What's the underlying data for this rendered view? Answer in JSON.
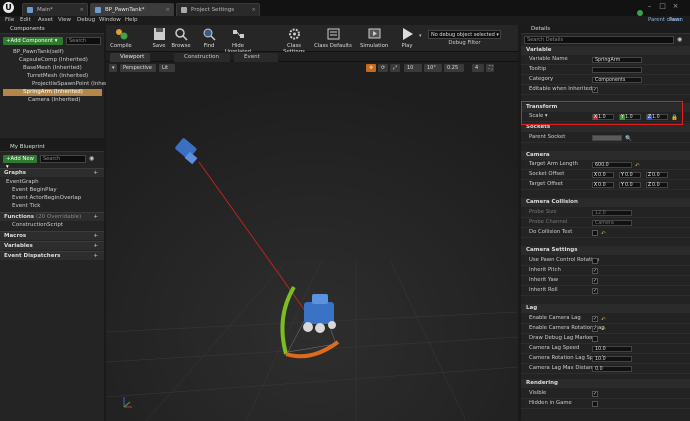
{
  "window": {
    "tabs": [
      {
        "label": "Main*"
      },
      {
        "label": "BP_PawnTank*"
      },
      {
        "label": "Project Settings"
      }
    ],
    "parent_class_label": "Parent class:",
    "parent_class_value": "Pawn Tank"
  },
  "menu": [
    "File",
    "Edit",
    "Asset",
    "View",
    "Debug",
    "Window",
    "Help"
  ],
  "toolbar": {
    "buttons": [
      {
        "label": "Compile"
      },
      {
        "label": "Save"
      },
      {
        "label": "Browse"
      },
      {
        "label": "Find"
      },
      {
        "label": "Hide Unrelated"
      },
      {
        "label": "Class Settings"
      },
      {
        "label": "Class Defaults"
      },
      {
        "label": "Simulation"
      },
      {
        "label": "Play"
      }
    ],
    "debug_selected": "No debug object selected ▾",
    "debug_filter": "Debug Filter"
  },
  "components": {
    "title": "Components",
    "add_label": "+Add Component ▾",
    "search_placeholder": "Search",
    "items": [
      {
        "label": "BP_PawnTank(self)"
      },
      {
        "label": "CapsuleComp (Inherited)"
      },
      {
        "label": "BaseMesh (Inherited)"
      },
      {
        "label": "TurretMesh (Inherited)"
      },
      {
        "label": "ProjectileSpawnPoint (Inherited)"
      },
      {
        "label": "SpringArm (Inherited)"
      },
      {
        "label": "Camera (Inherited)"
      }
    ]
  },
  "my_blueprint": {
    "title": "My Blueprint",
    "add_label": "+Add New ▾",
    "search_placeholder": "Search",
    "graphs": "Graphs",
    "eventgraph": "EventGraph",
    "events": [
      {
        "label": "Event BeginPlay"
      },
      {
        "label": "Event ActorBeginOverlap"
      },
      {
        "label": "Event Tick"
      }
    ],
    "functions": "Functions",
    "functions_overridable": "(20 Overridable)",
    "construction": "ConstructionScript",
    "macros": "Macros",
    "variables": "Variables",
    "dispatchers": "Event Dispatchers"
  },
  "editor_tabs": [
    {
      "label": "Viewport"
    },
    {
      "label": "Construction Scrip"
    },
    {
      "label": "Event Graph"
    }
  ],
  "viewport": {
    "perspective": "Perspective",
    "lit": "Lit",
    "snap": "10",
    "angle": "10°",
    "scale": "0.25",
    "cam": "4"
  },
  "details": {
    "title": "Details",
    "search_placeholder": "Search Details",
    "variable": {
      "title": "Variable",
      "rows": [
        {
          "label": "Variable Name",
          "value": "SpringArm"
        },
        {
          "label": "Tooltip",
          "value": ""
        },
        {
          "label": "Category",
          "value": "Components"
        },
        {
          "label": "Editable when Inherited",
          "value": "✓"
        }
      ]
    },
    "transform": {
      "title": "Transform",
      "scale_label": "Scale ▾",
      "x": "1.0",
      "y": "1.0",
      "z": "1.0"
    },
    "sockets": {
      "title": "Sockets",
      "parent_socket": "Parent Socket"
    },
    "camera": {
      "title": "Camera",
      "arm_length_label": "Target Arm Length",
      "arm_length": "600.0",
      "socket_offset_label": "Socket Offset",
      "target_offset_label": "Target Offset",
      "zero": "0.0"
    },
    "collision": {
      "title": "Camera Collision",
      "probe_size_label": "Probe Size",
      "probe_size": "12.0",
      "probe_channel_label": "Probe Channel",
      "probe_channel": "Camera",
      "do_collision": "Do Collision Test"
    },
    "camera_settings": {
      "title": "Camera Settings",
      "rows": [
        {
          "label": "Use Pawn Control Rotation"
        },
        {
          "label": "Inherit Pitch"
        },
        {
          "label": "Inherit Yaw"
        },
        {
          "label": "Inherit Roll"
        }
      ]
    },
    "lag": {
      "title": "Lag",
      "rows": [
        {
          "label": "Enable Camera Lag"
        },
        {
          "label": "Enable Camera Rotation Lag"
        },
        {
          "label": "Draw Debug Lag Markers"
        }
      ],
      "speed_label": "Camera Lag Speed",
      "speed": "10.0",
      "rot_speed_label": "Camera Rotation Lag Speed",
      "rot_speed": "10.0",
      "max_label": "Camera Lag Max Distance",
      "max": "0.0"
    },
    "rendering": {
      "title": "Rendering",
      "visible": "Visible",
      "hidden": "Hidden in Game"
    }
  },
  "colors": {
    "accent": "#b5864a",
    "highlight": "#e02020",
    "green": "#2e7a2e"
  }
}
